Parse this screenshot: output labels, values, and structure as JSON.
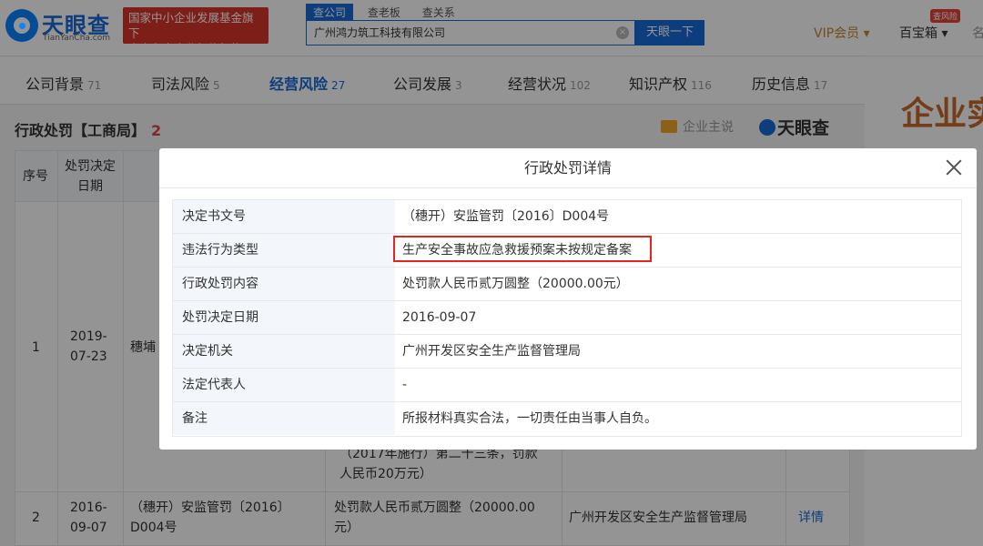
{
  "header": {
    "logo_text": "天眼查",
    "logo_sub": "TianYanCha.com",
    "gov_badge_line1": "国家中小企业发展基金旗下",
    "gov_badge_line2": "官方备案企业征信机构",
    "search_tabs": [
      "查公司",
      "查老板",
      "查关系"
    ],
    "search_value": "广州鸿力筑工科技有限公司",
    "search_button": "天眼一下",
    "vip": "VIP会员 ▾",
    "box": "百宝箱 ▾",
    "risk_badge": "查风险",
    "more": "名"
  },
  "nav": [
    {
      "label": "公司背景",
      "count": "71"
    },
    {
      "label": "司法风险",
      "count": "5"
    },
    {
      "label": "经营风险",
      "count": "27"
    },
    {
      "label": "公司发展",
      "count": "3"
    },
    {
      "label": "经营状况",
      "count": "102"
    },
    {
      "label": "知识产权",
      "count": "116"
    },
    {
      "label": "历史信息",
      "count": "17"
    }
  ],
  "side_title": "企业实",
  "section": {
    "title": "行政处罚【工商局】",
    "count": "2",
    "ad": "企业主说",
    "brand": "天眼查"
  },
  "bg_table": {
    "headers": [
      "序号",
      "处罚决定日期"
    ],
    "row1": {
      "index": "1",
      "date": "2019-07-23",
      "doc": "穗埔",
      "content": "（2017年施行）第二十三条，罚款人民币20万元）"
    },
    "row2": {
      "index": "2",
      "date": "2016-09-07",
      "doc": "（穗开）安监管罚〔2016〕D004号",
      "content": "处罚款人民币贰万圆整（20000.00元）",
      "authority": "广州开发区安全生产监督管理局",
      "detail": "详情"
    }
  },
  "modal": {
    "title": "行政处罚详情",
    "rows": [
      {
        "label": "决定书文号",
        "value": "（穗开）安监管罚〔2016〕D004号"
      },
      {
        "label": "违法行为类型",
        "value": "生产安全事故应急救援预案未按规定备案"
      },
      {
        "label": "行政处罚内容",
        "value": "处罚款人民币贰万圆整（20000.00元）"
      },
      {
        "label": "处罚决定日期",
        "value": "2016-09-07"
      },
      {
        "label": "决定机关",
        "value": "广州开发区安全生产监督管理局"
      },
      {
        "label": "法定代表人",
        "value": "-"
      },
      {
        "label": "备注",
        "value": "所报材料真实合法，一切责任由当事人自负。"
      }
    ]
  },
  "colors": {
    "brand_blue": "#1769d6",
    "badge_red": "#d9352b",
    "highlight_red": "#e5251c"
  }
}
